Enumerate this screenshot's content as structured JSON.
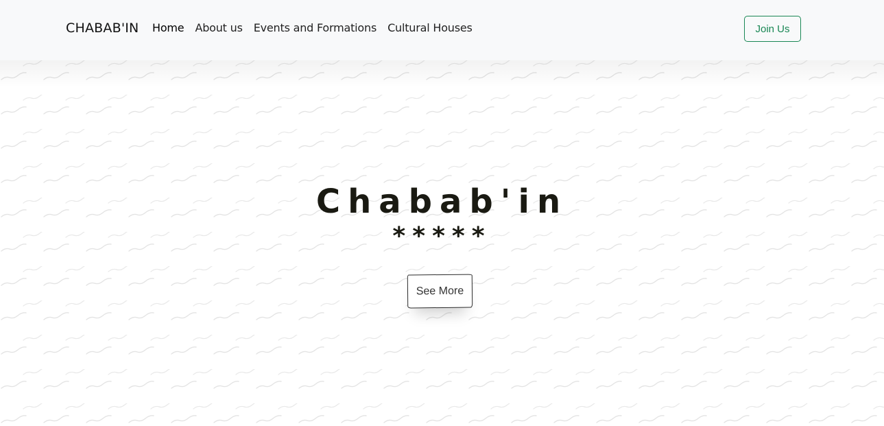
{
  "navbar": {
    "brand": "CHABAB'IN",
    "links": [
      {
        "label": "Home",
        "active": true
      },
      {
        "label": "About us",
        "active": false
      },
      {
        "label": "Events and Formations",
        "active": false
      },
      {
        "label": "Cultural Houses",
        "active": false
      }
    ],
    "join_label": "Join Us"
  },
  "hero": {
    "title": "Chabab'in",
    "stars": "*****",
    "cta_label": "See More"
  },
  "colors": {
    "navbar_bg": "#f8f9fa",
    "join_accent": "#198754",
    "title_color": "#1a1a12",
    "pattern_color": "#e6e6e6"
  }
}
